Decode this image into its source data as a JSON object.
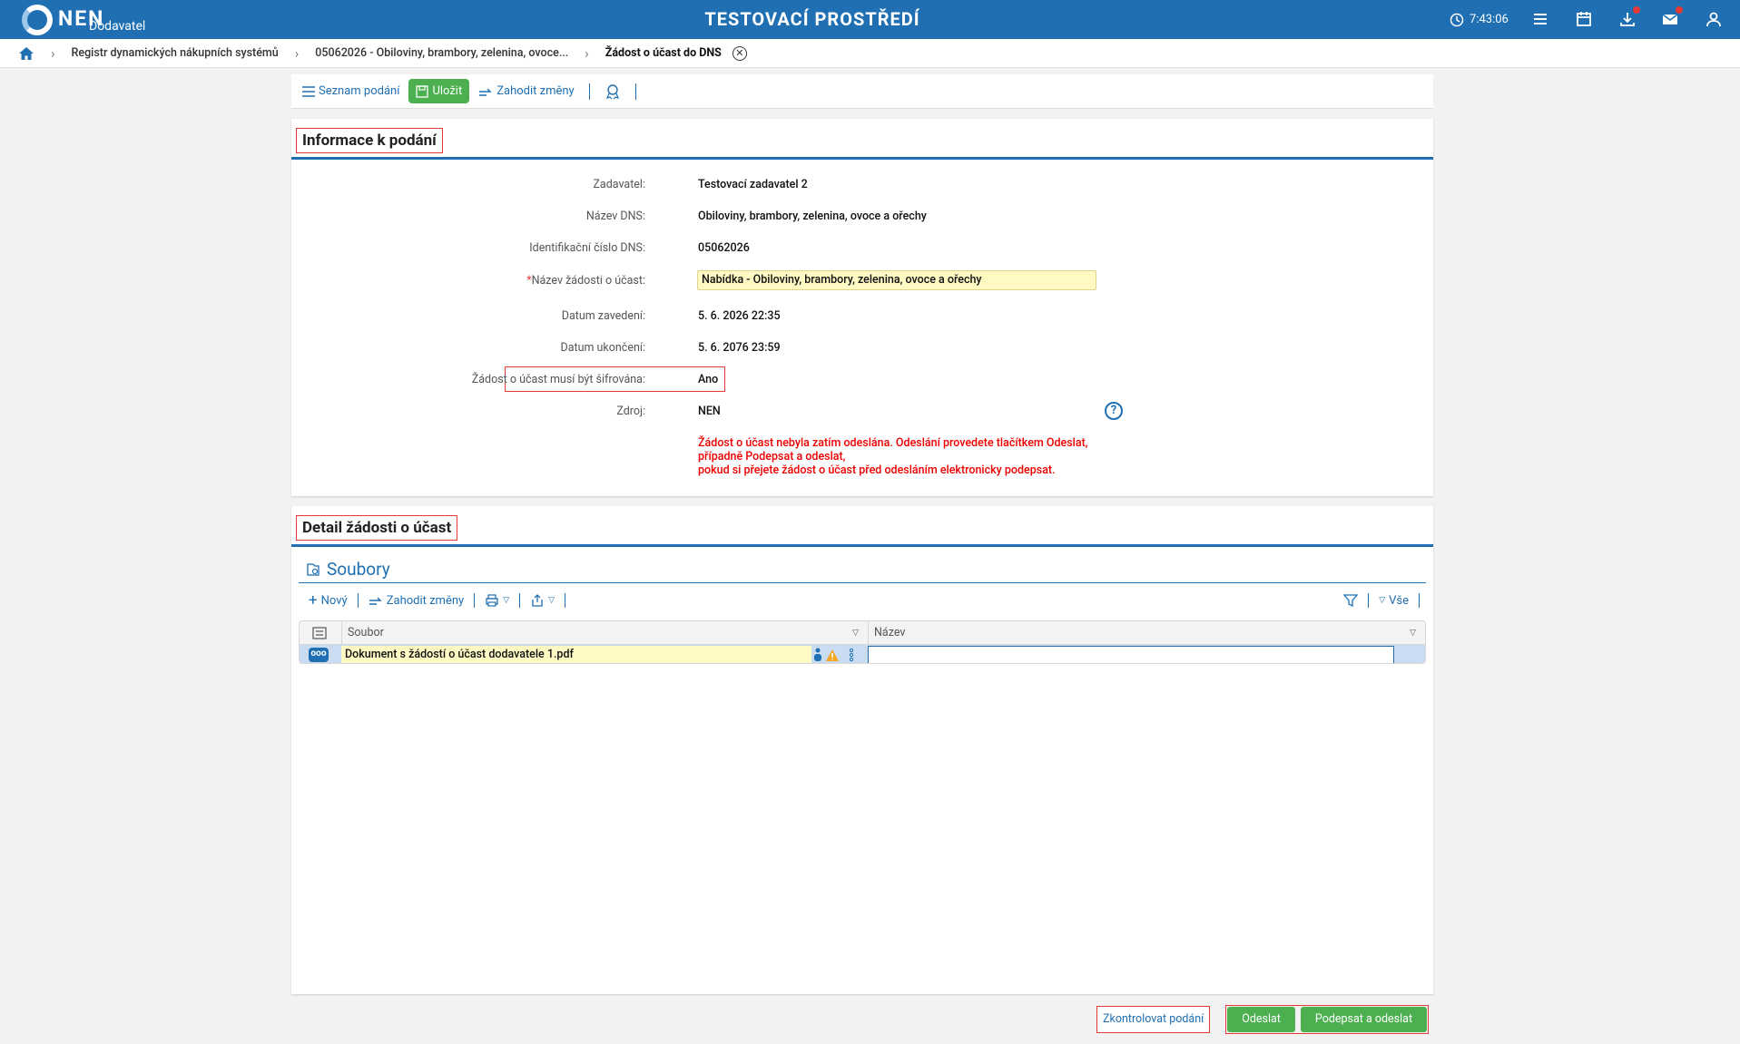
{
  "header": {
    "logo_text": "NEN",
    "logo_sub": "Dodavatel",
    "env_title": "TESTOVACÍ PROSTŘEDÍ",
    "time": "7:43:06",
    "icons": [
      "menu-icon",
      "calendar-icon",
      "download-icon",
      "mail-icon",
      "user-icon"
    ]
  },
  "breadcrumb": {
    "items": [
      "Registr dynamických nákupních systémů",
      "05062026 - Obiloviny, brambory, zelenina, ovoce..."
    ],
    "current": "Žádost o účast do DNS"
  },
  "toolbar": {
    "list_label": "Seznam podání",
    "save_label": "Uložit",
    "discard_label": "Zahodit změny"
  },
  "info_panel": {
    "title": "Informace k podání",
    "fields": [
      {
        "label": "Zadavatel:",
        "value": "Testovací zadavatel 2"
      },
      {
        "label": "Název DNS:",
        "value": "Obiloviny, brambory, zelenina, ovoce a ořechy"
      },
      {
        "label": "Identifikační číslo DNS:",
        "value": "05062026"
      },
      {
        "label": "Název žádosti o účast:",
        "value": "Nabídka - Obiloviny, brambory, zelenina, ovoce a ořechy",
        "required": "*"
      },
      {
        "label": "Datum zavedení:",
        "value": "5. 6. 2026 22:35"
      },
      {
        "label": "Datum ukončení:",
        "value": "5. 6. 2076 23:59"
      },
      {
        "label": "Žádost o účast musí být šifrována:",
        "value": "Ano"
      },
      {
        "label": "Zdroj:",
        "value": "NEN"
      }
    ],
    "help_glyph": "?",
    "warning_lines": [
      "Žádost o účast nebyla zatím odeslána. Odeslání provedete tlačítkem Odeslat,",
      "případně Podepsat a odeslat,",
      "pokud si přejete žádost o účast před odesláním elektronicky podepsat."
    ]
  },
  "detail_panel": {
    "title": "Detail žádosti o účast",
    "section_title": "Soubory",
    "toolbar": {
      "new_label": "Nový",
      "discard_label": "Zahodit změny",
      "filter_all_label": "Vše"
    },
    "grid": {
      "columns": [
        "Soubor",
        "Název"
      ],
      "rows": [
        {
          "file": "Dokument s žádostí o účast dodavatele 1.pdf",
          "name": ""
        }
      ],
      "row_action_glyph": "ooo"
    }
  },
  "actions": {
    "check_label": "Zkontrolovat podání",
    "send_label": "Odeslat",
    "sign_send_label": "Podepsat a odeslat"
  },
  "colors": {
    "brand": "#1f6fb2",
    "success": "#4caf50",
    "highlight": "#e53935",
    "input_bg": "#fff9c4"
  }
}
